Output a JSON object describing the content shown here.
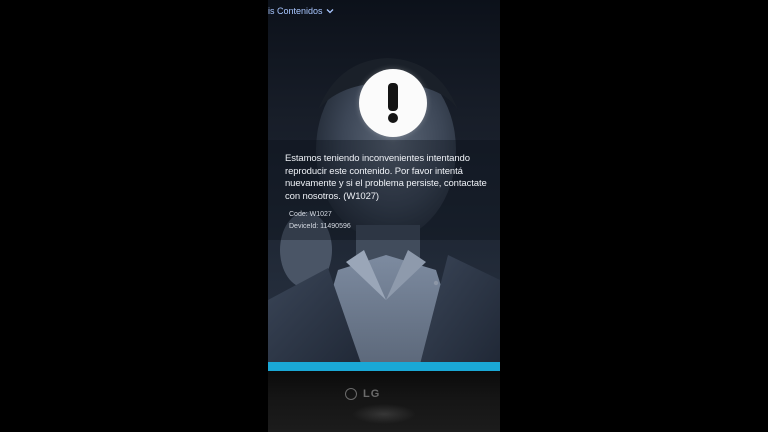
{
  "header": {
    "menu_label": "is Contenidos",
    "menu_icon": "chevron-down-icon"
  },
  "error_dialog": {
    "icon": "exclamation-icon",
    "message": "Estamos teniendo inconvenientes intentando reproducir este contenido. Por favor intentá nuevamente y si el problema persiste, contactate con nosotros. (W1027)",
    "code_text": "Code: W1027",
    "device_id_text": "DeviceId: 11490596"
  },
  "tv": {
    "brand": "LG"
  },
  "colors": {
    "menu_text": "#a9c7ff",
    "progress_bar": "#1aa8d6",
    "alert_circle": "#fbfbfb"
  }
}
